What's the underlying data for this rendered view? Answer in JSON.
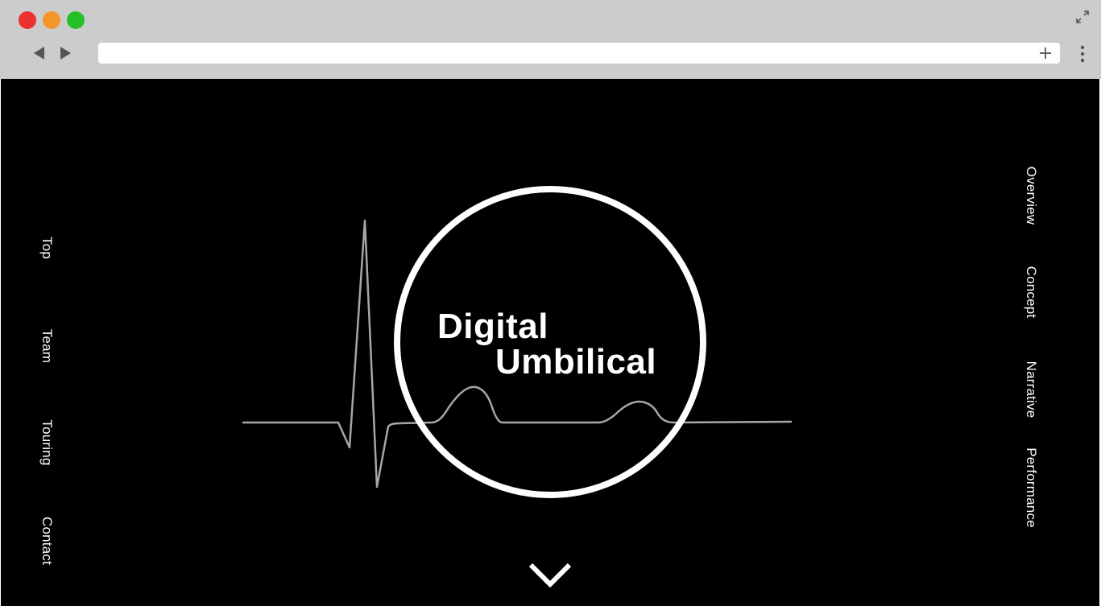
{
  "browser": {
    "url": ""
  },
  "left_nav": {
    "items": [
      {
        "label": "Top"
      },
      {
        "label": "Team"
      },
      {
        "label": "Touring"
      },
      {
        "label": "Contact"
      }
    ]
  },
  "right_nav": {
    "items": [
      {
        "label": "Overview"
      },
      {
        "label": "Concept"
      },
      {
        "label": "Narrative"
      },
      {
        "label": "Performance"
      }
    ]
  },
  "hero": {
    "title_line1": "Digital",
    "title_line2": "Umbilical",
    "graphic": "heartbeat-line-icon",
    "scroll_icon": "chevron-down-icon"
  },
  "colors": {
    "background": "#000000",
    "text": "#ffffff",
    "heartbeat_line": "#a6a6a6",
    "chrome": "#cccccc"
  }
}
